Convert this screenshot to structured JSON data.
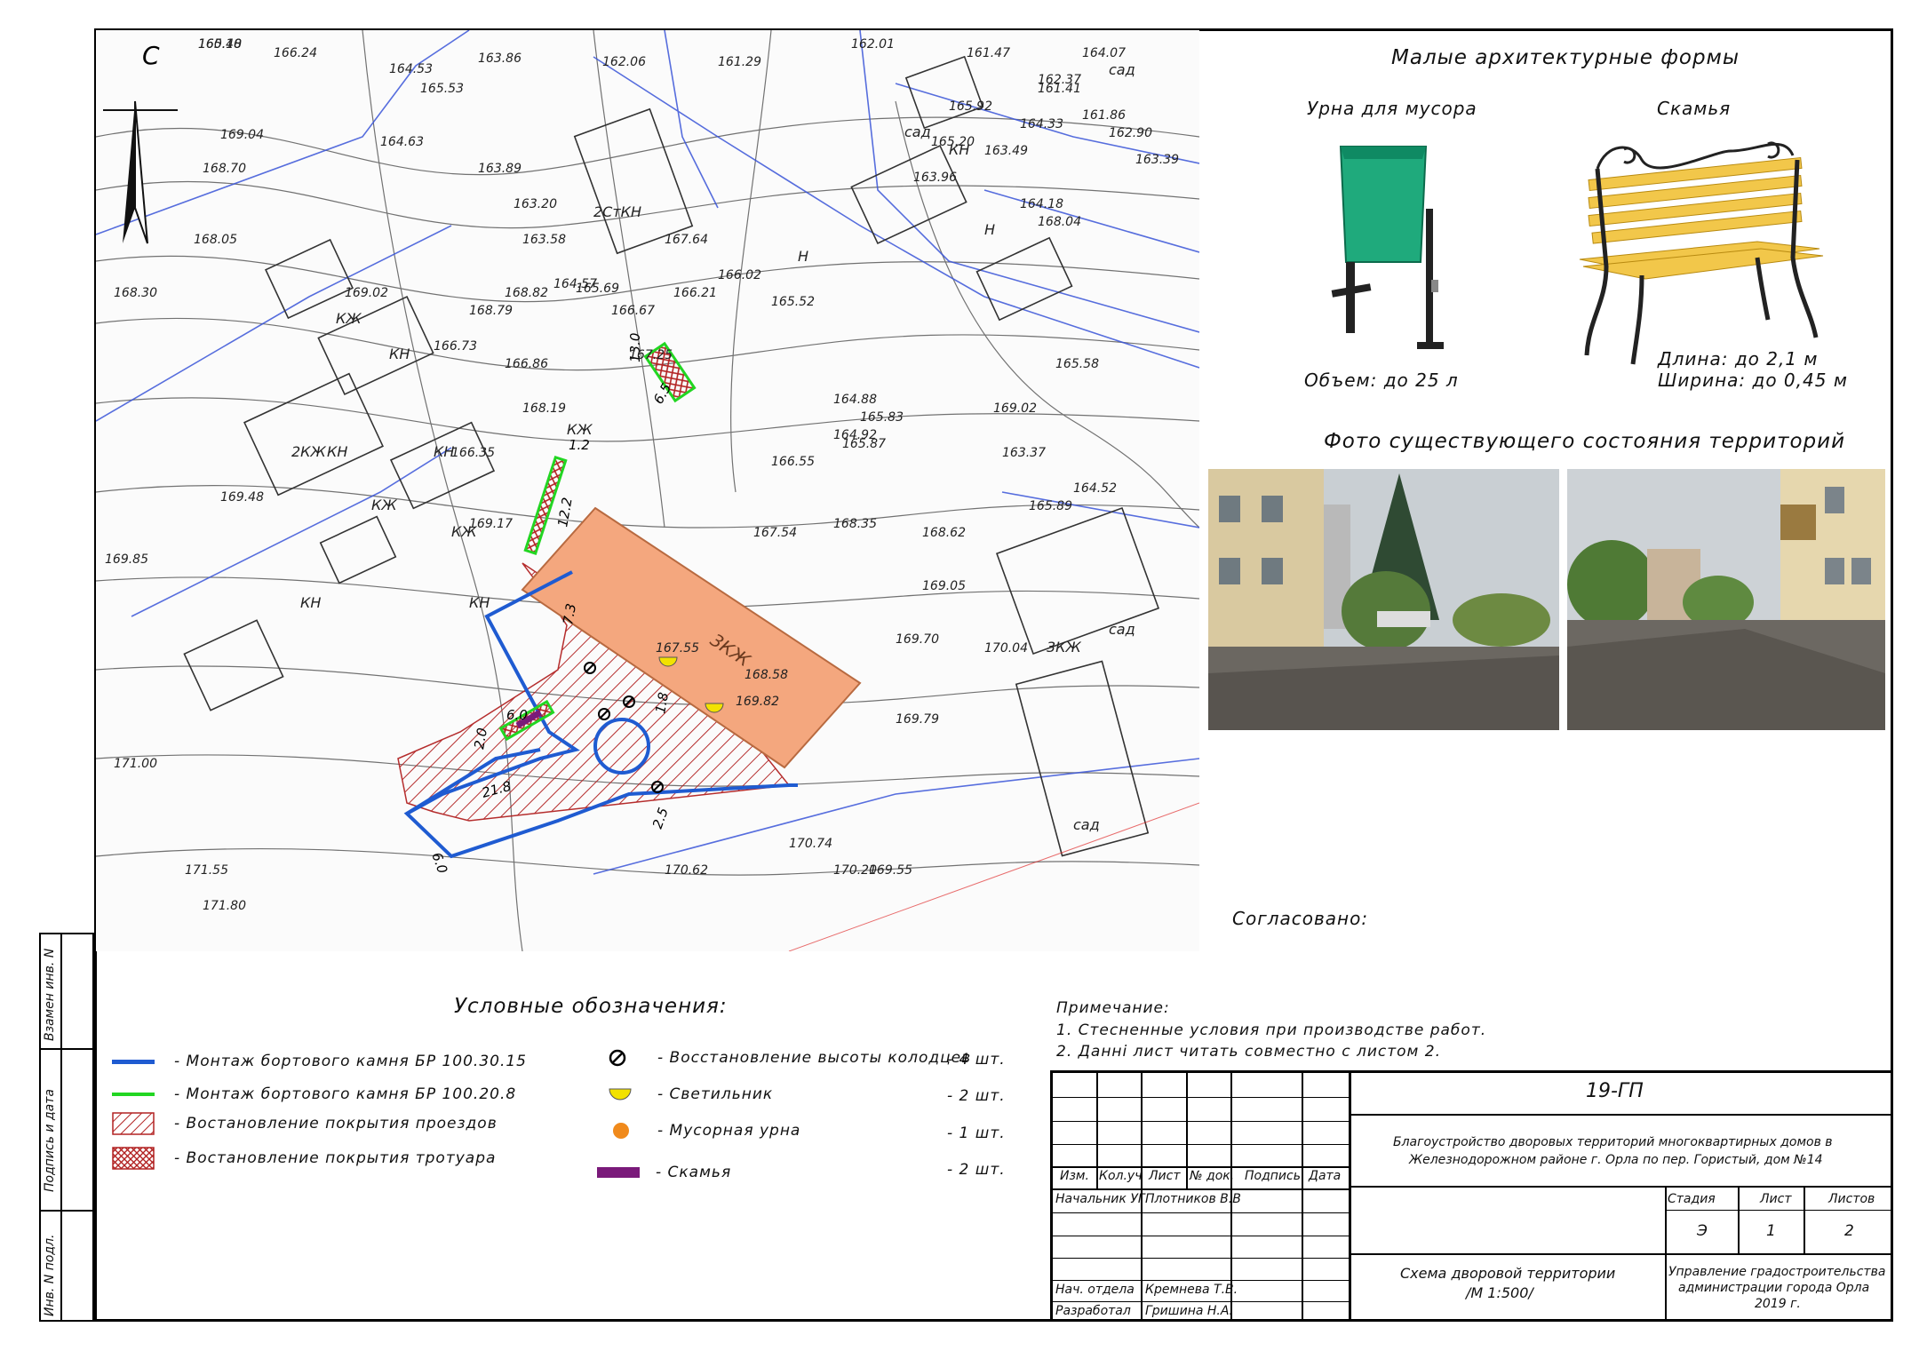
{
  "map": {
    "labels": [
      "165.48",
      "166.24",
      "164.53",
      "163.86",
      "162.06",
      "161.29",
      "162.01",
      "161.47",
      "169.04",
      "168.70",
      "168.05",
      "168.30",
      "165.53",
      "164.63",
      "163.89",
      "163.20",
      "163.58",
      "164.57",
      "165.69",
      "166.67",
      "167.25",
      "167.64",
      "166.21",
      "166.02",
      "165.52",
      "164.88",
      "164.92",
      "165.83",
      "166.55",
      "165.87",
      "167.54",
      "168.35",
      "169.05",
      "168.62",
      "170.04",
      "169.70",
      "169.79",
      "169.55",
      "170.20",
      "170.74",
      "170.62",
      "171.00",
      "171.55",
      "171.80",
      "169.82",
      "168.58",
      "167.55",
      "168.04",
      "169.02",
      "165.89",
      "163.37",
      "164.52",
      "165.58",
      "166.86",
      "166.73",
      "166.35",
      "168.19",
      "169.17",
      "169.48",
      "169.85",
      "168.79",
      "169.02",
      "168.82",
      "165.92",
      "165.20",
      "163.96",
      "163.49",
      "164.33",
      "164.18",
      "162.90",
      "163.39",
      "161.86",
      "161.41",
      "162.37",
      "164.07",
      "160.10"
    ],
    "tags": [
      "КЖ",
      "КН",
      "КЖ",
      "КЖ",
      "КН",
      "КН",
      "КЖ",
      "КН",
      "КН",
      "2КЖ",
      "3КЖ",
      "2СтКН",
      "сад",
      "сад",
      "сад",
      "сад",
      "КН",
      "Н",
      "Н"
    ],
    "compass": "С",
    "dimensions": {
      "d1": "13.0",
      "d2": "6.5",
      "d3": "1.2",
      "d4": "12.2",
      "d5": "7.3",
      "d6": "6.0",
      "d7": "2.0",
      "d8": "21.8",
      "d9": "1.8",
      "d10": "2.5",
      "d11": "6.0"
    }
  },
  "maf": {
    "title": "Малые архитектурные формы",
    "urn_title": "Урна для мусора",
    "bench_title": "Скамья",
    "urn_spec": "Объем: до 25 л",
    "bench_length": "Длина: до 2,1 м",
    "bench_width": "Ширина: до 0,45 м"
  },
  "photos": {
    "title": "Фото существующего состояния территорий"
  },
  "approved": "Согласовано:",
  "legend": {
    "title": "Условные обозначения:",
    "items": [
      {
        "label": "- Монтаж бортового камня БР 100.30.15"
      },
      {
        "label": "- Монтаж бортового камня БР 100.20.8"
      },
      {
        "label": "- Востановление покрытия проездов"
      },
      {
        "label": "- Востановление покрытия тротуара"
      }
    ],
    "counts": [
      {
        "label": "- Восстановление высоты колодцев",
        "qty": "- 4 шт."
      },
      {
        "label": "- Светильник",
        "qty": "- 2 шт."
      },
      {
        "label": "- Мусорная урна",
        "qty": "- 1 шт."
      },
      {
        "label": "- Скамья",
        "qty": "- 2 шт."
      }
    ]
  },
  "notes": {
    "title": "Примечание:",
    "n1": "1. Стесненные условия при производстве работ.",
    "n2": "2. Данні лист читать совместно с листом 2."
  },
  "stamp": {
    "code": "19-ГП",
    "project": "Благоустройство дворовых территорий многоквартирных домов в",
    "project2": "Железнодорожном районе г. Орла по пер. Гористый, дом №14",
    "cols": [
      "Изм.",
      "Кол.уч",
      "Лист",
      "№ док.",
      "Подпись",
      "Дата"
    ],
    "r1_role": "Начальник УГ",
    "r1_name": "Плотников В.В",
    "r2_role": "Нач. отдела",
    "r2_name": "Кремнева Т.В.",
    "r3_role": "Разработал",
    "r3_name": "Гришина Н.А.",
    "stage_h": "Стадия",
    "sheet_h": "Лист",
    "sheets_h": "Листов",
    "stage": "Э",
    "sheet": "1",
    "sheets": "2",
    "scheme": "Схема дворовой территории",
    "scale": "/М 1:500/",
    "org1": "Управление градостроительства",
    "org2": "администрации города Орла",
    "org3": "2019 г."
  },
  "side": {
    "s1": "Взамен инв. N",
    "s2": "Подпись и дата",
    "s3": "Инв. N подл."
  },
  "colors": {
    "blue_curb": "#1f5bd1",
    "green_curb": "#22d622",
    "hatch": "#b22222",
    "building": "#f4a77e",
    "bench": "#7a1a7a",
    "urn": "#f08a1c",
    "lamp": "#f2e200"
  }
}
